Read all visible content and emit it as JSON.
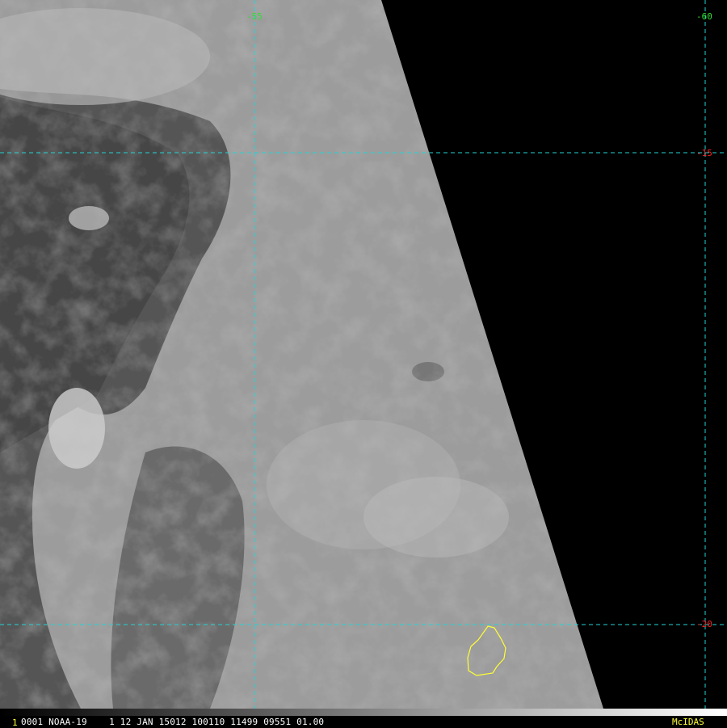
{
  "imagery": {
    "satellite": "NOAA-19",
    "colors": {
      "coastline": "#ffff33",
      "grid_line": "#22d4d4",
      "longitude_label": "#33dd33",
      "latitude_label": "#ee2222",
      "status_text": "#ffffff",
      "frame_index": "#ffff33",
      "brand": "#ffff33",
      "no_data": "#000000"
    }
  },
  "grid": {
    "longitude_labels": [
      "-55",
      "-60"
    ],
    "latitude_labels": [
      "-15",
      "-20"
    ]
  },
  "status_bar": {
    "frame_index": "1",
    "info": "0001 NOAA-19    1 12 JAN 15012 100110 11499 09551 01.00",
    "brand": "McIDAS"
  }
}
